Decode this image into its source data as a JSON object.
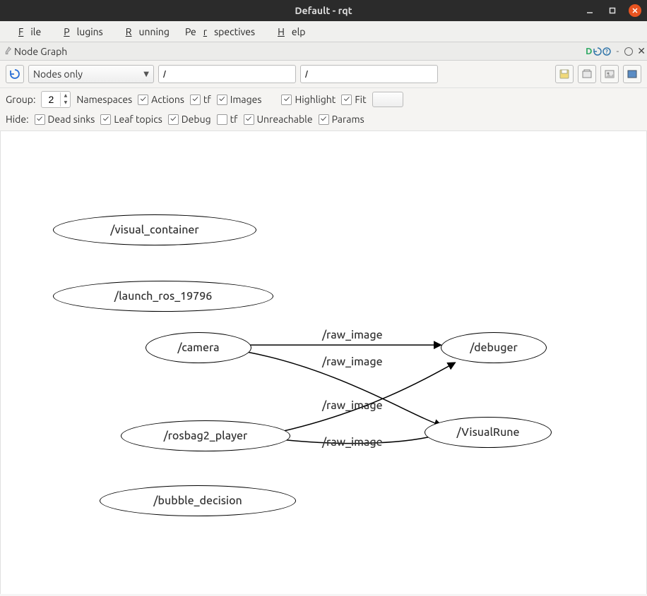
{
  "window": {
    "title": "Default - rqt"
  },
  "menu": {
    "file": "File",
    "plugins": "Plugins",
    "running": "Running",
    "perspectives": "Perspectives",
    "help": "Help"
  },
  "plugin": {
    "title": "Node Graph"
  },
  "filter": {
    "view_mode": "Nodes only",
    "path1": "/",
    "path2": "/"
  },
  "group": {
    "label": "Group:",
    "value": "2",
    "namespaces": "Namespaces",
    "actions": "Actions",
    "tf": "tf",
    "images": "Images",
    "highlight": "Highlight",
    "fit": "Fit"
  },
  "hide": {
    "label": "Hide:",
    "deadsinks": "Dead sinks",
    "leaftopics": "Leaf topics",
    "debug": "Debug",
    "tf": "tf",
    "unreachable": "Unreachable",
    "params": "Params"
  },
  "graph": {
    "nodes": {
      "visual_container": "/visual_container",
      "launch_ros": "/launch_ros_19796",
      "camera": "/camera",
      "rosbag2_player": "/rosbag2_player",
      "bubble_decision": "/bubble_decision",
      "debuger": "/debuger",
      "visualrune": "/VisualRune"
    },
    "edges": {
      "e1": "/raw_image",
      "e2": "/raw_image",
      "e3": "/raw_image",
      "e4": "/raw_image"
    }
  }
}
